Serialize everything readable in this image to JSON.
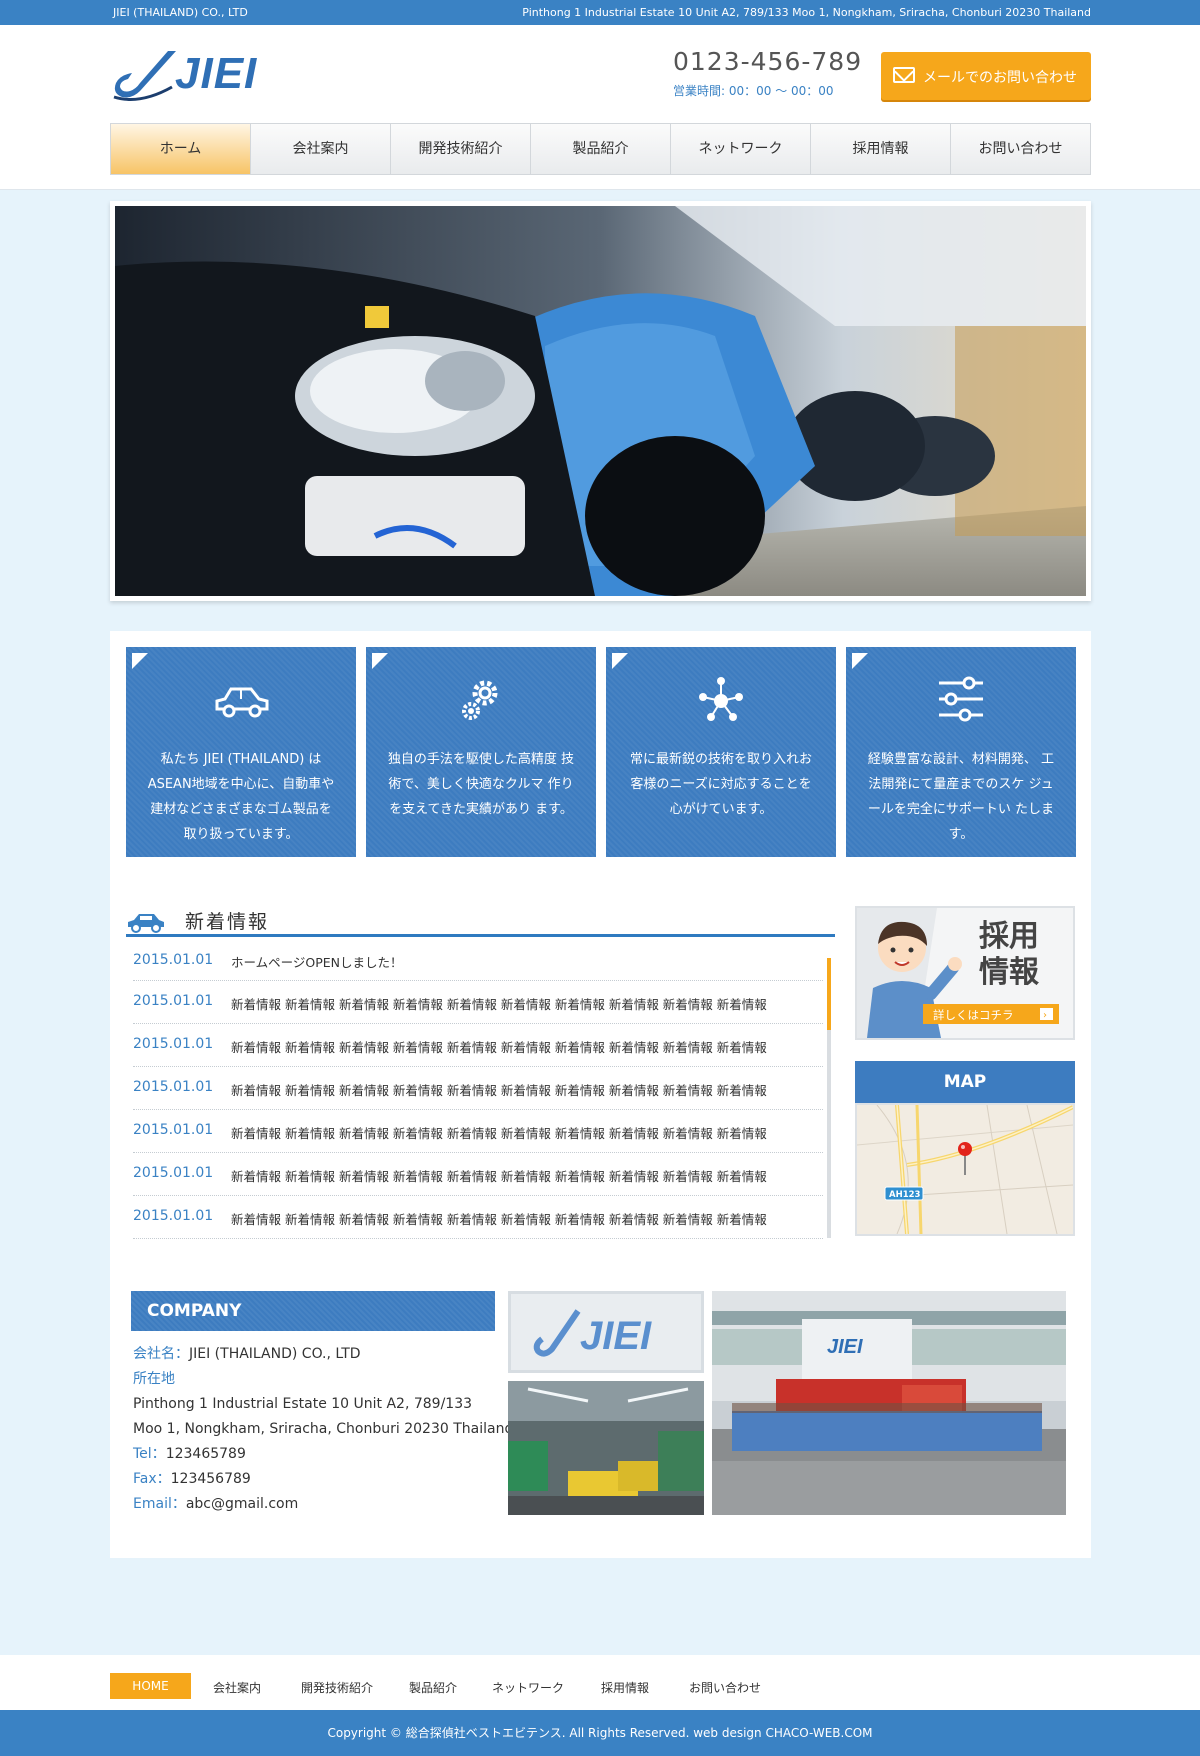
{
  "topbar": {
    "company": "JIEI (THAILAND) CO., LTD",
    "address": "Pinthong 1 Industrial Estate 10 Unit A2, 789/133 Moo 1, Nongkham, Sriracha, Chonburi 20230 Thailand"
  },
  "header": {
    "logo": "JIEI",
    "phone": "0123-456-789",
    "hours": "営業時間: 00：00 〜 00：00",
    "mail_button": "メールでのお問い合わせ"
  },
  "nav": [
    "ホーム",
    "会社案内",
    "開発技術紹介",
    "製品紹介",
    "ネットワーク",
    "採用情報",
    "お問い合わせ"
  ],
  "features": [
    {
      "icon": "car-icon",
      "text": "私たち JIEI (THAILAND) は ASEAN地域を中心に、自動車や 建材などさまざまなゴム製品を 取り扱っています。"
    },
    {
      "icon": "gears-icon",
      "text": "独自の手法を駆使した高精度 技術で、美しく快適なクルマ 作りを支えてきた実績があり ます。"
    },
    {
      "icon": "network-icon",
      "text": "常に最新鋭の技術を取り入れお 客様のニーズに対応することを 心がけています。"
    },
    {
      "icon": "sliders-icon",
      "text": "経験豊富な設計、材料開発、 工法開発にて量産までのスケ ジュールを完全にサポートい たします。"
    }
  ],
  "news": {
    "title": "新着情報",
    "items": [
      {
        "date": "2015.01.01",
        "text": "ホームページOPENしました！"
      },
      {
        "date": "2015.01.01",
        "text": "新着情報 新着情報 新着情報 新着情報 新着情報 新着情報 新着情報 新着情報 新着情報 新着情報"
      },
      {
        "date": "2015.01.01",
        "text": "新着情報 新着情報 新着情報 新着情報 新着情報 新着情報 新着情報 新着情報 新着情報 新着情報"
      },
      {
        "date": "2015.01.01",
        "text": "新着情報 新着情報 新着情報 新着情報 新着情報 新着情報 新着情報 新着情報 新着情報 新着情報"
      },
      {
        "date": "2015.01.01",
        "text": "新着情報 新着情報 新着情報 新着情報 新着情報 新着情報 新着情報 新着情報 新着情報 新着情報"
      },
      {
        "date": "2015.01.01",
        "text": "新着情報 新着情報 新着情報 新着情報 新着情報 新着情報 新着情報 新着情報 新着情報 新着情報"
      },
      {
        "date": "2015.01.01",
        "text": "新着情報 新着情報 新着情報 新着情報 新着情報 新着情報 新着情報 新着情報 新着情報 新着情報"
      }
    ]
  },
  "recruit_banner": {
    "title_line1": "採用",
    "title_line2": "情報",
    "button": "詳しくはコチラ"
  },
  "map": {
    "title": "MAP",
    "road_label": "AH123"
  },
  "company": {
    "heading": "COMPANY",
    "name_label": "会社名：",
    "name": "JIEI (THAILAND) CO., LTD",
    "location_label": "所在地",
    "address_line1": "Pinthong 1 Industrial Estate 10 Unit A2, 789/133",
    "address_line2": "Moo 1, Nongkham, Sriracha, Chonburi 20230 Thailand",
    "tel_label": "Tel：",
    "tel": "123465789",
    "fax_label": "Fax：",
    "fax": "123456789",
    "email_label": "Email：",
    "email": "abc@gmail.com",
    "photo_logo_text": "JIEI",
    "photo_building_text": "JIEI"
  },
  "footer": {
    "nav": [
      "HOME",
      "会社案内",
      "開発技術紹介",
      "製品紹介",
      "ネットワーク",
      "採用情報",
      "お問い合わせ"
    ],
    "copyright": "Copyright © 総合探偵社ベストエビテンス. All Rights Reserved. web design CHACO-WEB.COM"
  },
  "colors": {
    "primary": "#3a82c4",
    "accent": "#f6a71b",
    "background": "#e6f3fb"
  }
}
